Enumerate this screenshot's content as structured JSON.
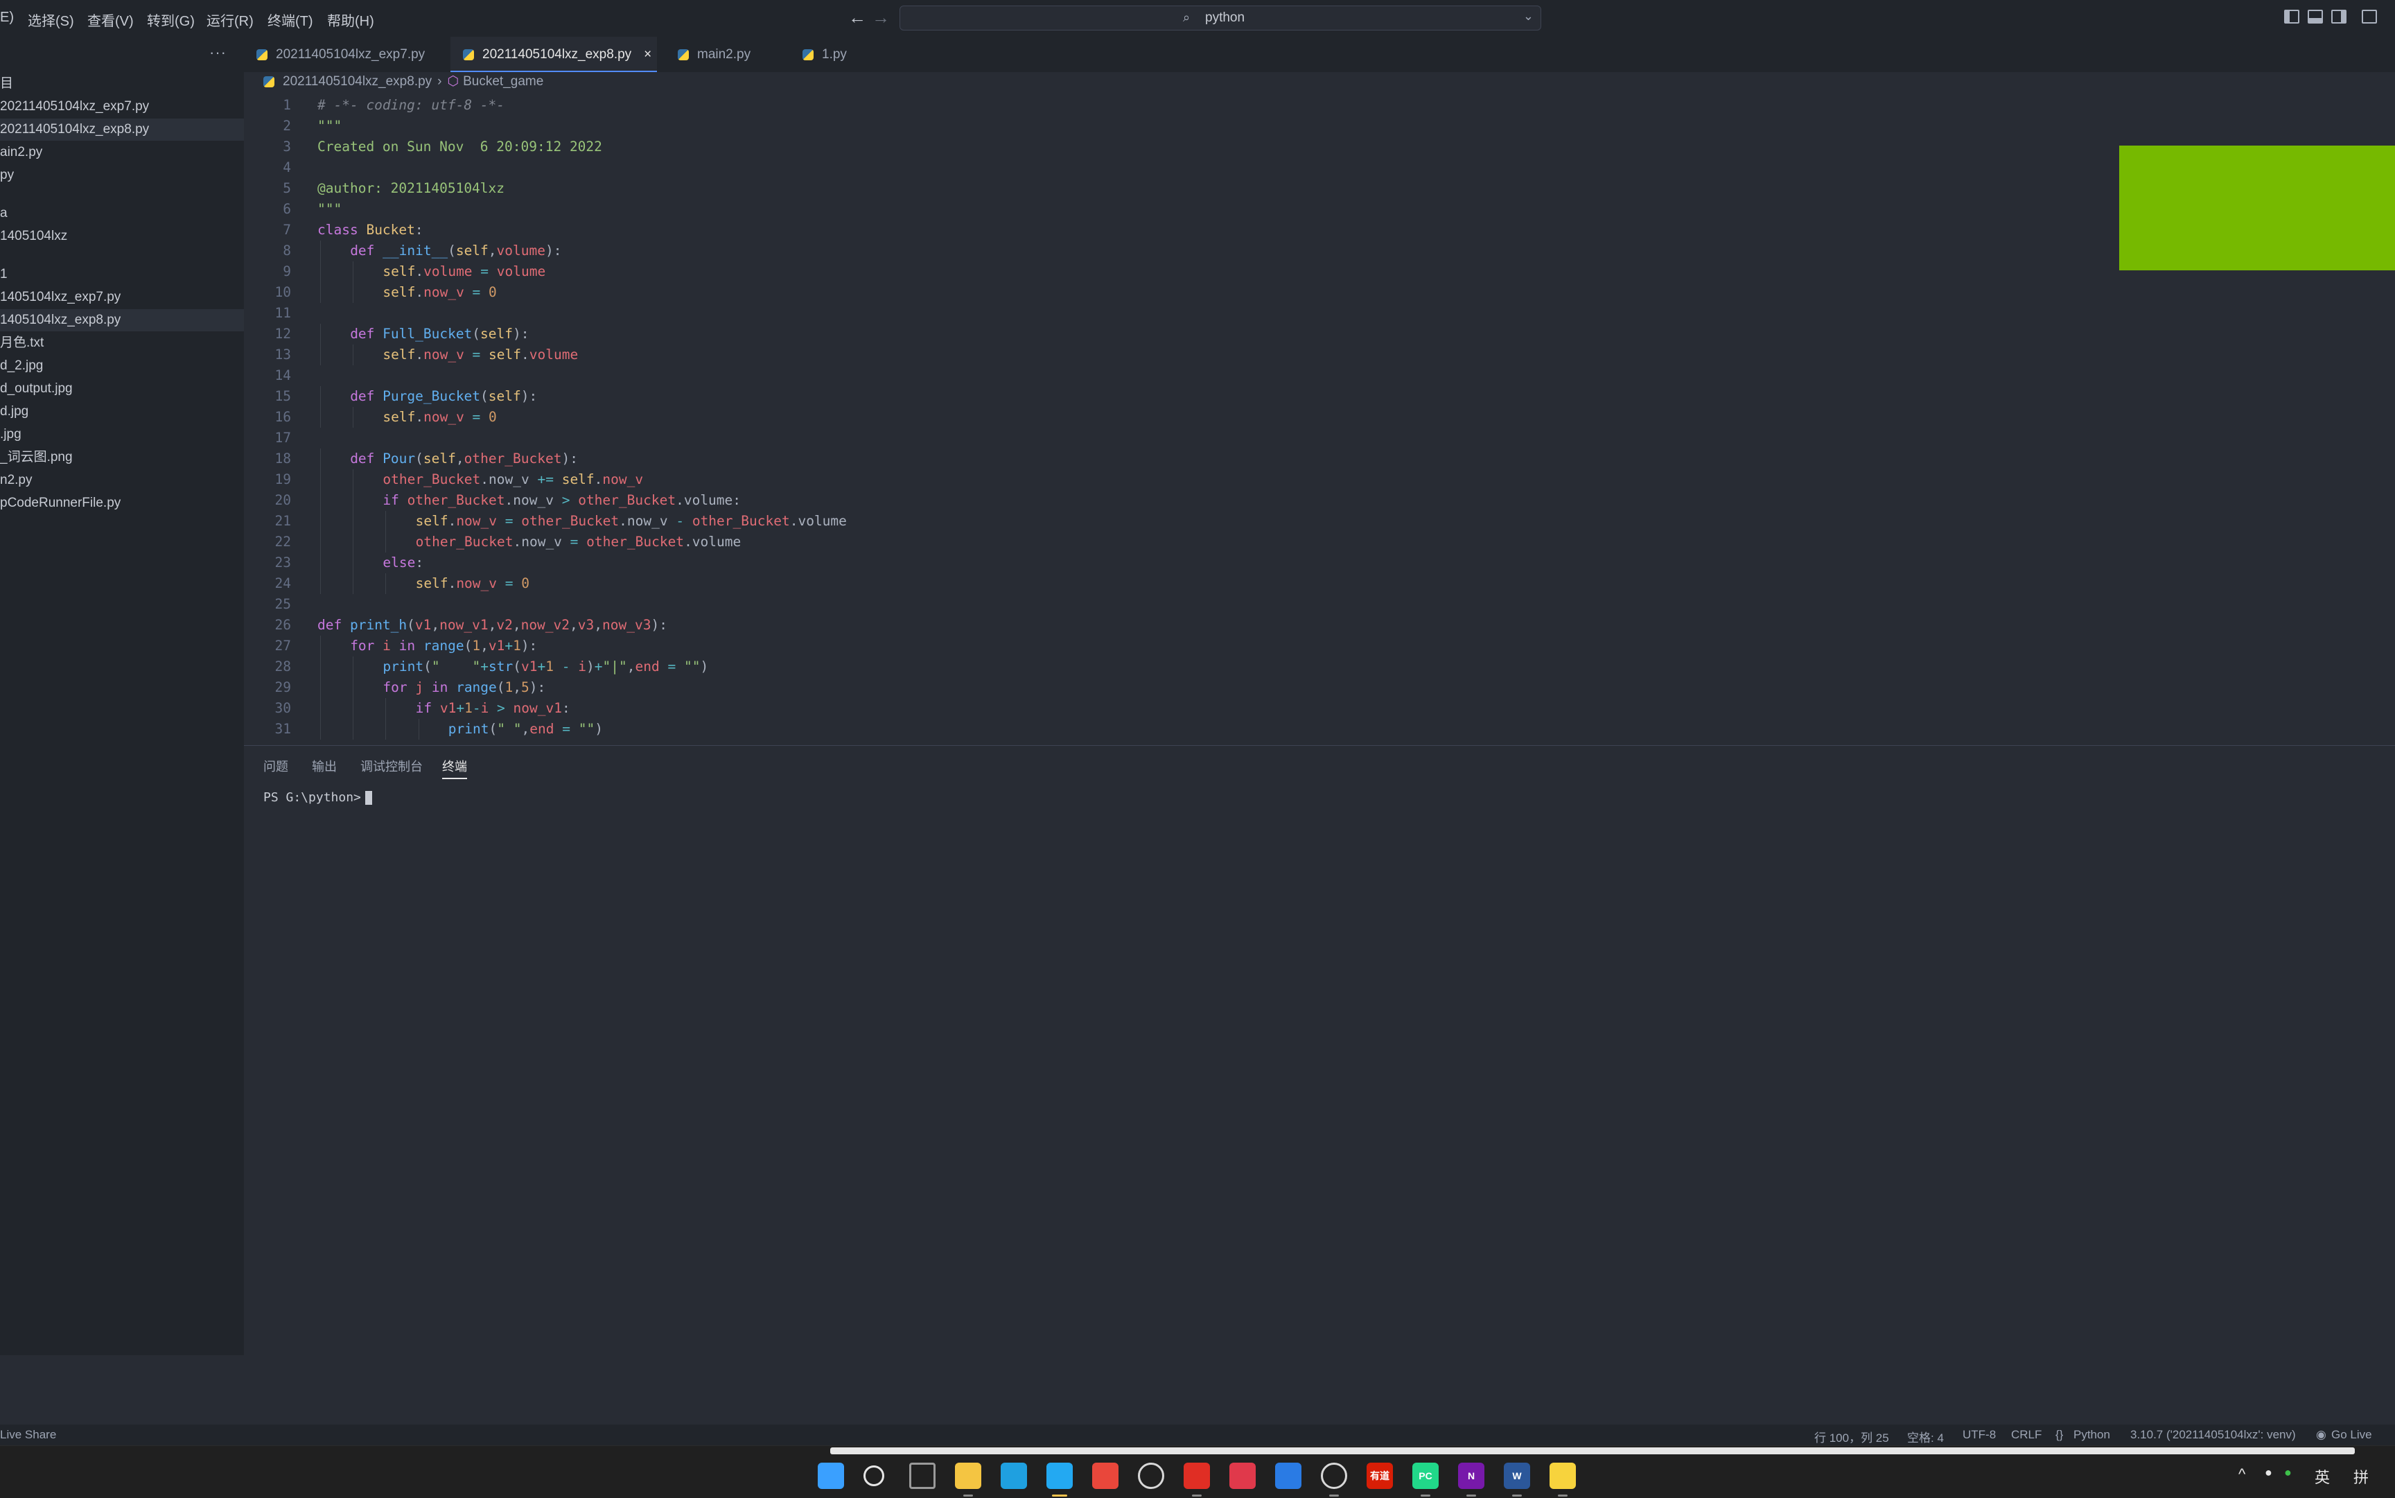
{
  "titlebar": {
    "menu": [
      "E)",
      "选择(S)",
      "查看(V)",
      "转到(G)",
      "运行(R)",
      "终端(T)",
      "帮助(H)"
    ],
    "search_text": "python"
  },
  "sidebar": {
    "more": "···",
    "items": [
      {
        "label": "目",
        "selected": false
      },
      {
        "label": "20211405104lxz_exp7.py",
        "selected": false
      },
      {
        "label": "20211405104lxz_exp8.py",
        "selected": true
      },
      {
        "label": "ain2.py",
        "selected": false
      },
      {
        "label": "py",
        "selected": false
      },
      {
        "label": "a",
        "selected": false
      },
      {
        "label": "1405104lxz",
        "selected": false
      },
      {
        "label": "1",
        "selected": false
      },
      {
        "label": "1405104lxz_exp7.py",
        "selected": false
      },
      {
        "label": "1405104lxz_exp8.py",
        "selected": true
      },
      {
        "label": "月色.txt",
        "selected": false
      },
      {
        "label": "d_2.jpg",
        "selected": false
      },
      {
        "label": "d_output.jpg",
        "selected": false
      },
      {
        "label": "d.jpg",
        "selected": false
      },
      {
        "label": ".jpg",
        "selected": false
      },
      {
        "label": "_词云图.png",
        "selected": false
      },
      {
        "label": "n2.py",
        "selected": false
      },
      {
        "label": "pCodeRunnerFile.py",
        "selected": false
      }
    ]
  },
  "tabs": [
    {
      "label": "20211405104lxz_exp7.py",
      "active": false
    },
    {
      "label": "20211405104lxz_exp8.py",
      "active": true
    },
    {
      "label": "main2.py",
      "active": false
    },
    {
      "label": "1.py",
      "active": false
    }
  ],
  "tab_close_symbol": "×",
  "breadcrumb": {
    "file": "20211405104lxz_exp8.py",
    "symbol": "Bucket_game"
  },
  "code_lines": [
    {
      "n": "1",
      "indent": 0,
      "parts": [
        [
          "cm",
          "# -*- coding: utf-8 -*-"
        ]
      ]
    },
    {
      "n": "2",
      "indent": 0,
      "parts": [
        [
          "str",
          "\"\"\""
        ]
      ]
    },
    {
      "n": "3",
      "indent": 0,
      "parts": [
        [
          "str",
          "Created on Sun Nov  6 20:09:12 2022"
        ]
      ]
    },
    {
      "n": "4",
      "indent": 0,
      "parts": []
    },
    {
      "n": "5",
      "indent": 0,
      "parts": [
        [
          "str",
          "@author: 20211405104lxz"
        ]
      ]
    },
    {
      "n": "6",
      "indent": 0,
      "parts": [
        [
          "str",
          "\"\"\""
        ]
      ]
    },
    {
      "n": "7",
      "indent": 0,
      "parts": [
        [
          "kw",
          "class "
        ],
        [
          "cls",
          "Bucket"
        ],
        [
          "p",
          ":"
        ]
      ]
    },
    {
      "n": "8",
      "indent": 1,
      "parts": [
        [
          "kw",
          "def "
        ],
        [
          "fn",
          "__init__"
        ],
        [
          "p",
          "("
        ],
        [
          "self",
          "self"
        ],
        [
          "p",
          ","
        ],
        [
          "param",
          "volume"
        ],
        [
          "p",
          "):"
        ]
      ]
    },
    {
      "n": "9",
      "indent": 2,
      "parts": [
        [
          "self",
          "self"
        ],
        [
          "p",
          "."
        ],
        [
          "prop",
          "volume"
        ],
        [
          "op",
          " = "
        ],
        [
          "param",
          "volume"
        ]
      ]
    },
    {
      "n": "10",
      "indent": 2,
      "parts": [
        [
          "self",
          "self"
        ],
        [
          "p",
          "."
        ],
        [
          "prop",
          "now_v"
        ],
        [
          "op",
          " = "
        ],
        [
          "num",
          "0"
        ]
      ]
    },
    {
      "n": "11",
      "indent": 0,
      "parts": []
    },
    {
      "n": "12",
      "indent": 1,
      "parts": [
        [
          "kw",
          "def "
        ],
        [
          "fn",
          "Full_Bucket"
        ],
        [
          "p",
          "("
        ],
        [
          "self",
          "self"
        ],
        [
          "p",
          "):"
        ]
      ]
    },
    {
      "n": "13",
      "indent": 2,
      "parts": [
        [
          "self",
          "self"
        ],
        [
          "p",
          "."
        ],
        [
          "prop",
          "now_v"
        ],
        [
          "op",
          " = "
        ],
        [
          "self",
          "self"
        ],
        [
          "p",
          "."
        ],
        [
          "prop",
          "volume"
        ]
      ]
    },
    {
      "n": "14",
      "indent": 0,
      "parts": []
    },
    {
      "n": "15",
      "indent": 1,
      "parts": [
        [
          "kw",
          "def "
        ],
        [
          "fn",
          "Purge_Bucket"
        ],
        [
          "p",
          "("
        ],
        [
          "self",
          "self"
        ],
        [
          "p",
          "):"
        ]
      ]
    },
    {
      "n": "16",
      "indent": 2,
      "parts": [
        [
          "self",
          "self"
        ],
        [
          "p",
          "."
        ],
        [
          "prop",
          "now_v"
        ],
        [
          "op",
          " = "
        ],
        [
          "num",
          "0"
        ]
      ]
    },
    {
      "n": "17",
      "indent": 0,
      "parts": []
    },
    {
      "n": "18",
      "indent": 1,
      "parts": [
        [
          "kw",
          "def "
        ],
        [
          "fn",
          "Pour"
        ],
        [
          "p",
          "("
        ],
        [
          "self",
          "self"
        ],
        [
          "p",
          ","
        ],
        [
          "param",
          "other_Bucket"
        ],
        [
          "p",
          "):"
        ]
      ]
    },
    {
      "n": "19",
      "indent": 2,
      "parts": [
        [
          "param",
          "other_Bucket"
        ],
        [
          "p",
          ".now_v"
        ],
        [
          "op",
          " += "
        ],
        [
          "self",
          "self"
        ],
        [
          "p",
          "."
        ],
        [
          "prop",
          "now_v"
        ]
      ]
    },
    {
      "n": "20",
      "indent": 2,
      "parts": [
        [
          "kw",
          "if "
        ],
        [
          "param",
          "other_Bucket"
        ],
        [
          "p",
          ".now_v"
        ],
        [
          "op",
          " > "
        ],
        [
          "param",
          "other_Bucket"
        ],
        [
          "p",
          ".volume:"
        ]
      ]
    },
    {
      "n": "21",
      "indent": 3,
      "parts": [
        [
          "self",
          "self"
        ],
        [
          "p",
          "."
        ],
        [
          "prop",
          "now_v"
        ],
        [
          "op",
          " = "
        ],
        [
          "param",
          "other_Bucket"
        ],
        [
          "p",
          ".now_v"
        ],
        [
          "op",
          " - "
        ],
        [
          "param",
          "other_Bucket"
        ],
        [
          "p",
          ".volume"
        ]
      ]
    },
    {
      "n": "22",
      "indent": 3,
      "parts": [
        [
          "param",
          "other_Bucket"
        ],
        [
          "p",
          ".now_v"
        ],
        [
          "op",
          " = "
        ],
        [
          "param",
          "other_Bucket"
        ],
        [
          "p",
          ".volume"
        ]
      ]
    },
    {
      "n": "23",
      "indent": 2,
      "parts": [
        [
          "kw",
          "else"
        ],
        [
          "p",
          ":"
        ]
      ]
    },
    {
      "n": "24",
      "indent": 3,
      "parts": [
        [
          "self",
          "self"
        ],
        [
          "p",
          "."
        ],
        [
          "prop",
          "now_v"
        ],
        [
          "op",
          " = "
        ],
        [
          "num",
          "0"
        ]
      ]
    },
    {
      "n": "25",
      "indent": 0,
      "parts": []
    },
    {
      "n": "26",
      "indent": 0,
      "parts": [
        [
          "kw",
          "def "
        ],
        [
          "fn",
          "print_h"
        ],
        [
          "p",
          "("
        ],
        [
          "param",
          "v1"
        ],
        [
          "p",
          ","
        ],
        [
          "param",
          "now_v1"
        ],
        [
          "p",
          ","
        ],
        [
          "param",
          "v2"
        ],
        [
          "p",
          ","
        ],
        [
          "param",
          "now_v2"
        ],
        [
          "p",
          ","
        ],
        [
          "param",
          "v3"
        ],
        [
          "p",
          ","
        ],
        [
          "param",
          "now_v3"
        ],
        [
          "p",
          "):"
        ]
      ]
    },
    {
      "n": "27",
      "indent": 1,
      "parts": [
        [
          "kw",
          "for "
        ],
        [
          "param",
          "i"
        ],
        [
          "kw",
          " in "
        ],
        [
          "fn",
          "range"
        ],
        [
          "p",
          "("
        ],
        [
          "num",
          "1"
        ],
        [
          "p",
          ","
        ],
        [
          "param",
          "v1"
        ],
        [
          "op",
          "+"
        ],
        [
          "num",
          "1"
        ],
        [
          "p",
          "):"
        ]
      ]
    },
    {
      "n": "28",
      "indent": 2,
      "parts": [
        [
          "fn",
          "print"
        ],
        [
          "p",
          "("
        ],
        [
          "str",
          "\"    \""
        ],
        [
          "op",
          "+"
        ],
        [
          "fn",
          "str"
        ],
        [
          "p",
          "("
        ],
        [
          "param",
          "v1"
        ],
        [
          "op",
          "+"
        ],
        [
          "num",
          "1"
        ],
        [
          "op",
          " - "
        ],
        [
          "param",
          "i"
        ],
        [
          "p",
          ")"
        ],
        [
          "op",
          "+"
        ],
        [
          "str",
          "\"|\""
        ],
        [
          "p",
          ","
        ],
        [
          "param",
          "end"
        ],
        [
          "op",
          " = "
        ],
        [
          "str",
          "\"\""
        ],
        [
          "p",
          ")"
        ]
      ]
    },
    {
      "n": "29",
      "indent": 2,
      "parts": [
        [
          "kw",
          "for "
        ],
        [
          "param",
          "j"
        ],
        [
          "kw",
          " in "
        ],
        [
          "fn",
          "range"
        ],
        [
          "p",
          "("
        ],
        [
          "num",
          "1"
        ],
        [
          "p",
          ","
        ],
        [
          "num",
          "5"
        ],
        [
          "p",
          "):"
        ]
      ]
    },
    {
      "n": "30",
      "indent": 3,
      "parts": [
        [
          "kw",
          "if "
        ],
        [
          "param",
          "v1"
        ],
        [
          "op",
          "+"
        ],
        [
          "num",
          "1"
        ],
        [
          "op",
          "-"
        ],
        [
          "param",
          "i"
        ],
        [
          "op",
          " > "
        ],
        [
          "param",
          "now_v1"
        ],
        [
          "p",
          ":"
        ]
      ]
    },
    {
      "n": "31",
      "indent": 4,
      "parts": [
        [
          "fn",
          "print"
        ],
        [
          "p",
          "("
        ],
        [
          "str",
          "\" \""
        ],
        [
          "p",
          ","
        ],
        [
          "param",
          "end"
        ],
        [
          "op",
          " = "
        ],
        [
          "str",
          "\"\""
        ],
        [
          "p",
          ")"
        ]
      ]
    }
  ],
  "panel": {
    "tabs": [
      {
        "label": "问题",
        "active": false
      },
      {
        "label": "输出",
        "active": false
      },
      {
        "label": "调试控制台",
        "active": false
      },
      {
        "label": "终端",
        "active": true
      }
    ],
    "prompt": "PS G:\\python>"
  },
  "statusbar": {
    "live_share": "Live Share",
    "position": "行 100，列 25",
    "spaces": "空格: 4",
    "encoding": "UTF-8",
    "eol": "CRLF",
    "language": "Python",
    "interpreter": "3.10.7 ('20211405104lxz': venv)",
    "go_live": "Go Live"
  },
  "taskbar": {
    "apps": [
      {
        "name": "windows-start-icon",
        "color": "#3aa0ff",
        "label": ""
      },
      {
        "name": "search-icon",
        "color": "#202020",
        "label": ""
      },
      {
        "name": "task-view-icon",
        "color": "#202020",
        "label": ""
      },
      {
        "name": "file-explorer-icon",
        "color": "#f4c542",
        "label": ""
      },
      {
        "name": "edge-icon",
        "color": "#1fa0e0",
        "label": ""
      },
      {
        "name": "vscode-icon",
        "color": "#23a9f2",
        "label": ""
      },
      {
        "name": "chrome-icon",
        "color": "#e9473b",
        "label": ""
      },
      {
        "name": "pinwheel-icon",
        "color": "#202020",
        "label": ""
      },
      {
        "name": "netease-music-icon",
        "color": "#e02e24",
        "label": ""
      },
      {
        "name": "music-app-icon",
        "color": "#e0394b",
        "label": ""
      },
      {
        "name": "photos-icon",
        "color": "#2a7be4",
        "label": ""
      },
      {
        "name": "obs-icon",
        "color": "#202020",
        "label": ""
      },
      {
        "name": "youdao-icon",
        "color": "#d81e06",
        "label": "有道"
      },
      {
        "name": "pycharm-icon",
        "color": "#21d789",
        "label": "PC"
      },
      {
        "name": "onenote-icon",
        "color": "#7719aa",
        "label": "N"
      },
      {
        "name": "word-icon",
        "color": "#2b579a",
        "label": "W"
      },
      {
        "name": "sticky-notes-icon",
        "color": "#f7d33d",
        "label": ""
      }
    ],
    "tray": {
      "ime_lang": "英",
      "ime_mode": "拼",
      "chevron": "^"
    }
  }
}
